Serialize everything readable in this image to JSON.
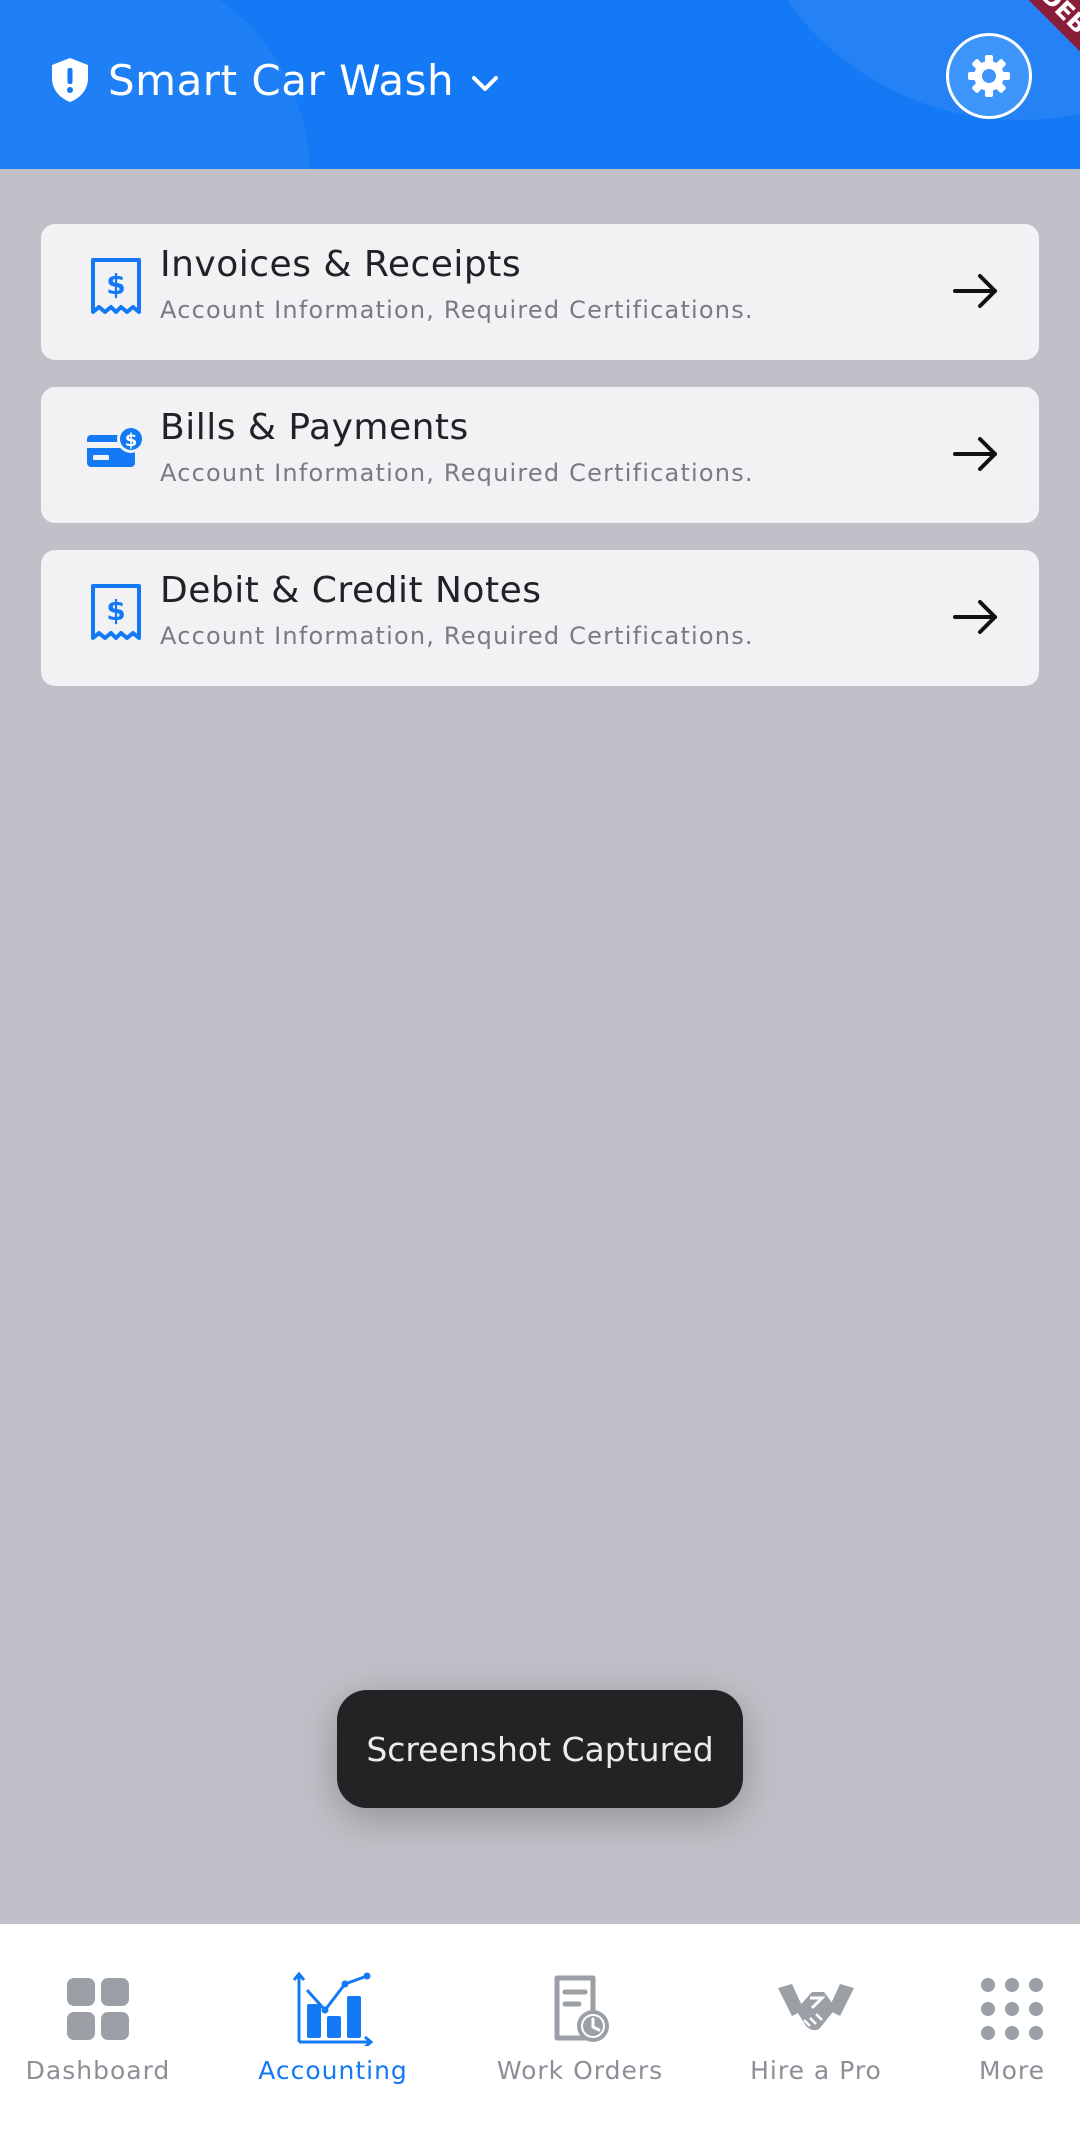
{
  "header": {
    "title": "Smart Car Wash",
    "debug_label": "DEBUG",
    "bg_color": "#1479f5"
  },
  "cards": [
    {
      "title": "Invoices & Receipts",
      "subtitle": "Account Information, Required Certifications.",
      "icon": "receipt-dollar-icon"
    },
    {
      "title": "Bills & Payments",
      "subtitle": "Account Information, Required Certifications.",
      "icon": "card-payment-icon"
    },
    {
      "title": "Debit & Credit Notes",
      "subtitle": "Account Information, Required Certifications.",
      "icon": "receipt-dollar-icon"
    }
  ],
  "toast": {
    "message": "Screenshot Captured"
  },
  "bottom_nav": {
    "active_color": "#1479f5",
    "inactive_color": "#8e8e96",
    "items": [
      {
        "label": "Dashboard",
        "icon": "grid-icon",
        "active": false
      },
      {
        "label": "Accounting",
        "icon": "chart-icon",
        "active": true
      },
      {
        "label": "Work Orders",
        "icon": "document-clock-icon",
        "active": false
      },
      {
        "label": "Hire a Pro",
        "icon": "handshake-icon",
        "active": false
      },
      {
        "label": "More",
        "icon": "dots-grid-icon",
        "active": false
      }
    ]
  }
}
